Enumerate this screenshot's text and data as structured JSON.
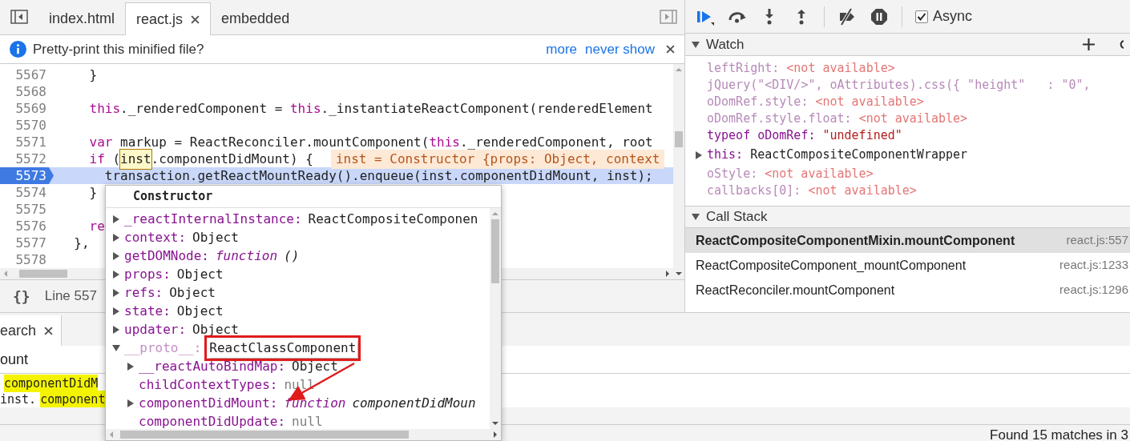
{
  "editor": {
    "tabs": [
      {
        "label": "index.html",
        "selected": false,
        "closable": false
      },
      {
        "label": "react.js",
        "selected": true,
        "closable": true
      },
      {
        "label": "embedded",
        "selected": false,
        "closable": false
      }
    ],
    "infobar": {
      "message": "Pretty-print this minified file?",
      "links": [
        "more",
        "never show"
      ]
    },
    "code_lines": [
      {
        "number": "5567",
        "execution": false,
        "segments": [
          {
            "kind": "plain",
            "text": "    }"
          }
        ]
      },
      {
        "number": "5568",
        "execution": false
      },
      {
        "number": "5569",
        "execution": false,
        "segments": [
          {
            "kind": "keyword",
            "text": "    this"
          },
          {
            "kind": "plain",
            "text": "._renderedComponent = "
          },
          {
            "kind": "keyword",
            "text": "this"
          },
          {
            "kind": "plain",
            "text": "._instantiateReactComponent(renderedElement"
          }
        ]
      },
      {
        "number": "5570",
        "execution": false
      },
      {
        "number": "5571",
        "execution": false,
        "segments": [
          {
            "kind": "keyword",
            "text": "    var"
          },
          {
            "kind": "plain",
            "text": " markup = ReactReconciler.mountComponent("
          },
          {
            "kind": "keyword",
            "text": "this"
          },
          {
            "kind": "plain",
            "text": "._renderedComponent, root"
          }
        ]
      },
      {
        "number": "5572",
        "execution": false,
        "segments": [
          {
            "kind": "keyword",
            "text": "    if"
          },
          {
            "kind": "plain",
            "text": " ("
          },
          {
            "kind": "hover",
            "text": "inst"
          },
          {
            "kind": "plain",
            "text": ".componentDidMount) {"
          },
          {
            "kind": "inline-value",
            "text": "inst = Constructor {props: Object, context"
          }
        ]
      },
      {
        "number": "5573",
        "execution": true,
        "segments": [
          {
            "kind": "plain",
            "text": "      transaction.getReactMountReady().enqueue(inst.componentDidMount, inst);"
          }
        ]
      },
      {
        "number": "5574",
        "execution": false,
        "segments": [
          {
            "kind": "plain",
            "text": "    }"
          }
        ]
      },
      {
        "number": "5575",
        "execution": false
      },
      {
        "number": "5576",
        "execution": false,
        "segments": [
          {
            "kind": "keyword",
            "text": "    re"
          }
        ]
      },
      {
        "number": "5577",
        "execution": false,
        "segments": [
          {
            "kind": "plain",
            "text": "  },"
          }
        ]
      },
      {
        "number": "5578",
        "execution": false
      }
    ],
    "status": {
      "brace": "{}",
      "position": "Line 557"
    }
  },
  "popover": {
    "title": "Constructor",
    "properties": [
      {
        "name": "_reactInternalInstance:",
        "expandable": true,
        "expanded": false,
        "kind": "object",
        "value": "ReactCompositeComponen"
      },
      {
        "name": "context:",
        "expandable": true,
        "expanded": false,
        "kind": "object",
        "value": "Object"
      },
      {
        "name": "getDOMNode:",
        "expandable": true,
        "expanded": false,
        "kind": "function",
        "keyword": "function",
        "value": "()"
      },
      {
        "name": "props:",
        "expandable": true,
        "expanded": false,
        "kind": "object",
        "value": "Object"
      },
      {
        "name": "refs:",
        "expandable": true,
        "expanded": false,
        "kind": "object",
        "value": "Object"
      },
      {
        "name": "state:",
        "expandable": true,
        "expanded": false,
        "kind": "object",
        "value": "Object"
      },
      {
        "name": "updater:",
        "expandable": true,
        "expanded": false,
        "kind": "object",
        "value": "Object"
      },
      {
        "name": "__proto__:",
        "expandable": true,
        "expanded": true,
        "internal": true,
        "annotated": true,
        "kind": "object",
        "value": "ReactClassComponent",
        "children": [
          {
            "name": "__reactAutoBindMap:",
            "expandable": true,
            "expanded": false,
            "kind": "object",
            "value": "Object"
          },
          {
            "name": "childContextTypes:",
            "expandable": false,
            "kind": "null",
            "value": "null"
          },
          {
            "name": "componentDidMount:",
            "expandable": true,
            "expanded": false,
            "kind": "function",
            "keyword": "function",
            "value": "componentDidMoun"
          },
          {
            "name": "componentDidUpdate:",
            "expandable": false,
            "kind": "null",
            "value": "null"
          }
        ]
      }
    ]
  },
  "drawer": {
    "tab": {
      "label": "earch",
      "selected": true
    },
    "search": {
      "value": "ount"
    },
    "results": [
      {
        "segments": [
          {
            "text": "componentDidM",
            "highlight": true
          }
        ]
      },
      {
        "segments": [
          {
            "text": "inst.",
            "highlight": false
          },
          {
            "text": "component",
            "highlight": true
          }
        ]
      }
    ],
    "status": "Found 15 matches in 3"
  },
  "debugger": {
    "async": {
      "label": "Async",
      "checked": true
    },
    "watch": {
      "title": "Watch",
      "expanded": true,
      "items": [
        {
          "name": "leftRight:",
          "available": false,
          "expandable": false,
          "value": "<not available>"
        },
        {
          "name": "jQuery(\"<DIV/>\", oAttributes).css({ \"height\"   : \"0\",",
          "available": false,
          "expandable": false
        },
        {
          "name": "oDomRef.style:",
          "available": false,
          "expandable": false,
          "value": "<not available>"
        },
        {
          "name": "oDomRef.style.float:",
          "available": false,
          "expandable": false,
          "value": "<not available>"
        },
        {
          "name": "typeof oDomRef:",
          "available": true,
          "expandable": false,
          "kind": "string",
          "value": "\"undefined\""
        },
        {
          "name": "this:",
          "available": true,
          "expandable": true,
          "kind": "object",
          "value": "ReactCompositeComponentWrapper"
        },
        {
          "name": "oStyle:",
          "available": false,
          "expandable": false,
          "value": "<not available>"
        },
        {
          "name": "callbacks[0]:",
          "available": false,
          "expandable": false,
          "value": "<not available>"
        }
      ]
    },
    "call_stack": {
      "title": "Call Stack",
      "expanded": true,
      "frames": [
        {
          "function": "ReactCompositeComponentMixin.mountComponent",
          "location": "react.js:557",
          "selected": true
        },
        {
          "function": "ReactCompositeComponent_mountComponent",
          "location": "react.js:1233",
          "selected": false
        },
        {
          "function": "ReactReconciler.mountComponent",
          "location": "react.js:1296",
          "selected": false
        }
      ]
    }
  }
}
